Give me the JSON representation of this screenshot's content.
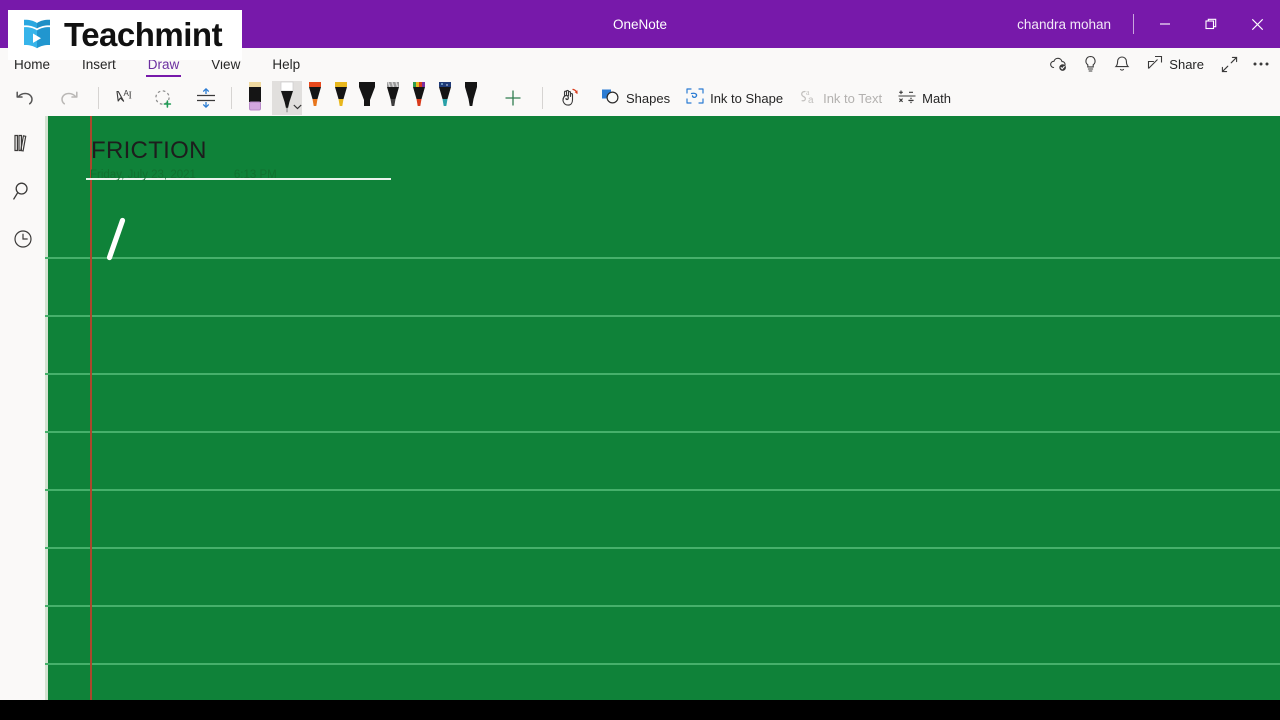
{
  "window": {
    "app_title": "OneNote",
    "account_name": "chandra mohan",
    "minimize_label": "Minimize",
    "restore_label": "Restore Down",
    "close_label": "Close",
    "accent_color": "#7719AA"
  },
  "logo": {
    "brand": "Teachmint",
    "icon": "book-play-icon"
  },
  "ribbon": {
    "tabs": [
      {
        "label": "Home",
        "active": false
      },
      {
        "label": "Insert",
        "active": false
      },
      {
        "label": "Draw",
        "active": true
      },
      {
        "label": "View",
        "active": false
      },
      {
        "label": "Help",
        "active": false
      }
    ],
    "right_items": [
      {
        "label": "Sync Status",
        "icon": "cloud-sync-icon"
      },
      {
        "label": "Tell me what you want to do",
        "icon": "lightbulb-icon"
      },
      {
        "label": "Notifications",
        "icon": "bell-icon"
      },
      {
        "label": "Share",
        "icon": "share-icon"
      },
      {
        "label": "Expand",
        "icon": "diagonal-arrows-icon"
      },
      {
        "label": "More Options",
        "icon": "ellipsis-icon"
      }
    ],
    "share_label": "Share"
  },
  "toolbar": {
    "undo_label": "Undo",
    "redo_label": "Redo",
    "select_text_label": "Type",
    "lasso_label": "Lasso Select",
    "insert_space_label": "Insert Space",
    "eraser_label": "Eraser",
    "add_pen_label": "Add Pen",
    "pens": [
      {
        "name": "white-pen",
        "barrel": "#1b1b1b",
        "cap": "#ffffff",
        "tip": "#ffffff",
        "selected": true
      },
      {
        "name": "orange-pen",
        "barrel": "#1b1b1b",
        "cap": "#e8491d",
        "tip": "#e8761d",
        "selected": false
      },
      {
        "name": "yellow-pen",
        "barrel": "#1b1b1b",
        "cap": "#e8b71d",
        "tip": "#e8b71d",
        "selected": false
      },
      {
        "name": "black-highlighter",
        "barrel": "#1b1b1b",
        "cap": "#1b1b1b",
        "tip": "#1b1b1b",
        "selected": false
      },
      {
        "name": "gray-pencil",
        "barrel": "#1b1b1b",
        "cap": "#8c8c8c",
        "tip": "#4a4a4a",
        "selected": false
      },
      {
        "name": "rainbow-pen",
        "barrel": "#1b1b1b",
        "cap": "#33aa44",
        "tip": "#d83b1c",
        "selected": false
      },
      {
        "name": "galaxy-pen",
        "barrel": "#1b1b1b",
        "cap": "#2a4f8f",
        "tip": "#2aa1a8",
        "selected": false
      },
      {
        "name": "black-pen",
        "barrel": "#1b1b1b",
        "cap": "#1b1b1b",
        "tip": "#1b1b1b",
        "selected": false
      }
    ],
    "ink_replay_label": "Ink Replay",
    "shapes_label": "Shapes",
    "ink_to_shape_label": "Ink to Shape",
    "ink_to_text_label": "Ink to Text",
    "ink_to_text_disabled": true,
    "math_label": "Math"
  },
  "sidebar": {
    "items": [
      {
        "label": "Show Notebooks",
        "icon": "notebooks-icon"
      },
      {
        "label": "Search",
        "icon": "search-icon"
      },
      {
        "label": "Recent Notes",
        "icon": "clock-icon"
      }
    ]
  },
  "page": {
    "title": "FRICTION",
    "date": "Friday, July 23, 2021",
    "time": "6:13 PM",
    "background_color": "#0f8239",
    "rule_color": "#46b06b",
    "margin_color": "#b4432c",
    "ink_stroke_color": "#ffffff"
  }
}
